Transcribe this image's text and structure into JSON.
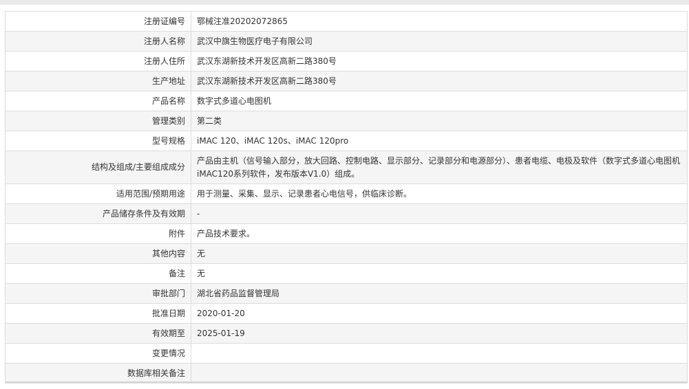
{
  "rows": [
    {
      "label": "注册证编号",
      "value": "鄂械注准20202072865"
    },
    {
      "label": "注册人名称",
      "value": "武汉中旗生物医疗电子有限公司"
    },
    {
      "label": "注册人住所",
      "value": "武汉东湖新技术开发区高新二路380号"
    },
    {
      "label": "生产地址",
      "value": "武汉东湖新技术开发区高新二路380号"
    },
    {
      "label": "产品名称",
      "value": "数字式多道心电图机"
    },
    {
      "label": "管理类别",
      "value": "第二类"
    },
    {
      "label": "型号规格",
      "value": "iMAC 120、iMAC 120s、iMAC 120pro"
    },
    {
      "label": "结构及组成/主要组成成分",
      "value": "产品由主机（信号输入部分，放大回路、控制电路、显示部分、记录部分和电源部分）、患者电缆、电极及软件（数字式多道心电图机iMAC120系列软件，发布版本V1.0）组成。"
    },
    {
      "label": "适用范围/预期用途",
      "value": "用于测量、采集、显示、记录患者心电信号，供临床诊断。"
    },
    {
      "label": "产品储存条件及有效期",
      "value": "-"
    },
    {
      "label": "附件",
      "value": "产品技术要求。"
    },
    {
      "label": "其他内容",
      "value": "无"
    },
    {
      "label": "备注",
      "value": "无"
    },
    {
      "label": "审批部门",
      "value": "湖北省药品监督管理局"
    },
    {
      "label": "批准日期",
      "value": "2020-01-20"
    },
    {
      "label": "有效期至",
      "value": "2025-01-19"
    },
    {
      "label": "变更情况",
      "value": ""
    },
    {
      "label": "数据库相关备注",
      "value": ""
    }
  ]
}
